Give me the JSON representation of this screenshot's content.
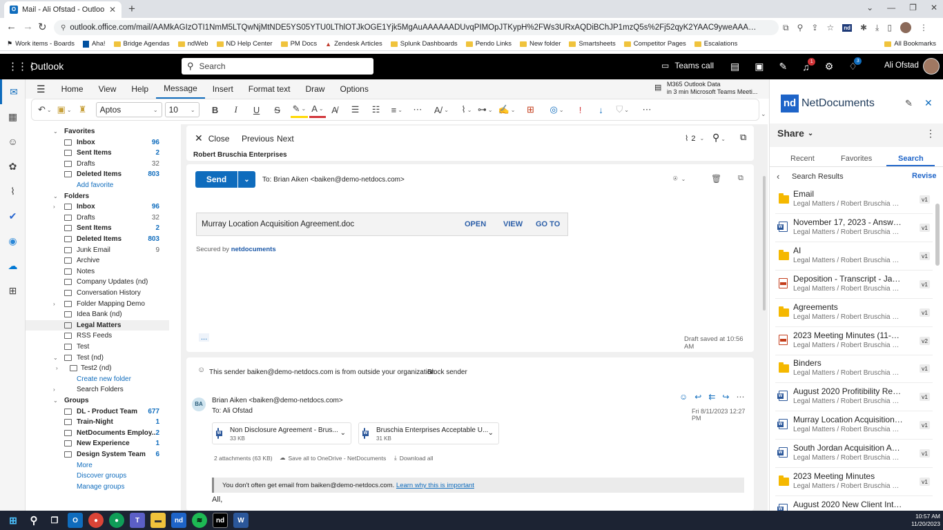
{
  "browser": {
    "tab_title": "Mail - Ali Ofstad - Outlook",
    "new_tab": "+",
    "url": "outlook.office.com/mail/AAMkAGIzOTI1NmM5LTQwNjMtNDE5YS05YTU0LThlOTJkOGE1Yjk5MgAuAAAAAADUvqPIMOpJTKypH%2FWs3URxAQDiBChJP1mzQ5s%2Fj52qyK2YAAC9yweAAAA%3D/id/AAQkAGIzOTI1NmM5LTQwNjMtNDE...",
    "bookmarks": [
      "Work items - Boards",
      "Aha!",
      "Bridge Agendas",
      "ndWeb",
      "ND Help Center",
      "PM Docs",
      "Zendesk Articles",
      "Splunk Dashboards",
      "Pendo Links",
      "New folder",
      "Smartsheets",
      "Competitor Pages",
      "Escalations"
    ],
    "all_bookmarks": "All Bookmarks"
  },
  "header": {
    "app_name": "Outlook",
    "search_placeholder": "Search",
    "teams_call": "Teams call",
    "user_name": "Ali Ofstad",
    "notif_count": "1",
    "tips_count": "3"
  },
  "ribbon": {
    "tabs": [
      "Home",
      "View",
      "Help",
      "Message",
      "Insert",
      "Format text",
      "Draw",
      "Options"
    ],
    "active_tab": "Message",
    "font": "Aptos",
    "size": "10",
    "meeting_title": "M365 Outlook Data",
    "meeting_sub": "in 3 min Microsoft Teams Meeti..."
  },
  "folders": {
    "favorites_label": "Favorites",
    "favorites": [
      {
        "name": "Inbox",
        "count": "96",
        "bold": true
      },
      {
        "name": "Sent Items",
        "count": "2",
        "bold": true
      },
      {
        "name": "Drafts",
        "count": "32",
        "bold": false
      },
      {
        "name": "Deleted Items",
        "count": "803",
        "bold": true
      }
    ],
    "add_favorite": "Add favorite",
    "folders_label": "Folders",
    "items": [
      {
        "name": "Inbox",
        "count": "96",
        "bold": true
      },
      {
        "name": "Drafts",
        "count": "32",
        "bold": false
      },
      {
        "name": "Sent Items",
        "count": "2",
        "bold": true
      },
      {
        "name": "Deleted Items",
        "count": "803",
        "bold": true
      },
      {
        "name": "Junk Email",
        "count": "9",
        "bold": false
      },
      {
        "name": "Archive",
        "count": "",
        "bold": false
      },
      {
        "name": "Notes",
        "count": "",
        "bold": false
      },
      {
        "name": "Company Updates (nd)",
        "count": "",
        "bold": false
      },
      {
        "name": "Conversation History",
        "count": "",
        "bold": false
      },
      {
        "name": "Folder Mapping Demo",
        "count": "",
        "bold": false
      },
      {
        "name": "Idea Bank (nd)",
        "count": "",
        "bold": false
      },
      {
        "name": "Legal Matters",
        "count": "",
        "bold": false
      },
      {
        "name": "RSS Feeds",
        "count": "",
        "bold": false
      },
      {
        "name": "Test",
        "count": "",
        "bold": false
      },
      {
        "name": "Test (nd)",
        "count": "",
        "bold": false
      }
    ],
    "sub_item": "Test2 (nd)",
    "create_new_folder": "Create new folder",
    "search_folders": "Search Folders",
    "groups_label": "Groups",
    "groups": [
      {
        "name": "DL - Product Team",
        "count": "677"
      },
      {
        "name": "Train-Night",
        "count": "1"
      },
      {
        "name": "NetDocuments Employ...",
        "count": "2"
      },
      {
        "name": "New Experience",
        "count": "1"
      },
      {
        "name": "Design System Team",
        "count": "6"
      }
    ],
    "more": "More",
    "discover_groups": "Discover groups",
    "manage_groups": "Manage groups"
  },
  "compose": {
    "close": "Close",
    "previous": "Previous",
    "next": "Next",
    "attach_count": "2",
    "subject": "Robert Bruschia Enterprises",
    "send": "Send",
    "to": "To: Brian Aiken <baiken@demo-netdocs.com>",
    "doc_name": "Murray Location Acquisition Agreement.doc",
    "open": "OPEN",
    "view": "VIEW",
    "goto": "GO TO",
    "secured_by": "Secured by",
    "secured_brand": "netdocuments",
    "ellipsis": "...",
    "draft_saved": "Draft saved at 10:56 AM"
  },
  "message": {
    "external_warning": "This sender baiken@demo-netdocs.com is from outside your organization.",
    "block_sender": "Block sender",
    "avatar": "BA",
    "from": "Brian Aiken <baiken@demo-netdocs.com>",
    "to": "To: Ali Ofstad",
    "date": "Fri 8/11/2023 12:27 PM",
    "attachments": [
      {
        "name": "Non Disclosure Agreement - Brus...",
        "size": "33 KB"
      },
      {
        "name": "Bruschia Enterprises Acceptable U...",
        "size": "31 KB"
      }
    ],
    "attach_summary": "2 attachments (63 KB)",
    "save_all": "Save all to OneDrive - NetDocuments",
    "download_all": "Download all",
    "infrequent": "You don't often get email from baiken@demo-netdocs.com.",
    "learn_why": "Learn why this is important",
    "body_start": "All,"
  },
  "nd_panel": {
    "logo": "nd",
    "brand": "NetDocuments",
    "share": "Share",
    "tabs": [
      "Recent",
      "Favorites",
      "Search"
    ],
    "active_tab": "Search",
    "results_label": "Search Results",
    "revise": "Revise",
    "results": [
      {
        "type": "folder",
        "title": "Email",
        "path": "Legal Matters / Robert Bruschia Ente...",
        "ver": "v1"
      },
      {
        "type": "word",
        "title": "November 17, 2023 - Answers",
        "path": "Legal Matters / Robert Bruschia Ente...",
        "ver": "v1"
      },
      {
        "type": "folder",
        "title": "AI",
        "path": "Legal Matters / Robert Bruschia Ente...",
        "ver": "v1"
      },
      {
        "type": "pdf",
        "title": "Deposition - Transcript - James ...",
        "path": "Legal Matters / Robert Bruschia Ente...",
        "ver": "v1"
      },
      {
        "type": "folder",
        "title": "Agreements",
        "path": "Legal Matters / Robert Bruschia Ente...",
        "ver": "v1"
      },
      {
        "type": "pdf",
        "title": "2023 Meeting Minutes (11-17-2...",
        "path": "Legal Matters / Robert Bruschia Ente...",
        "ver": "v2"
      },
      {
        "type": "folder",
        "title": "Binders",
        "path": "Legal Matters / Robert Bruschia Ente...",
        "ver": "v1"
      },
      {
        "type": "word",
        "title": "August 2020 Profitibility Report",
        "path": "Legal Matters / Robert Bruschia Ente...",
        "ver": "v1"
      },
      {
        "type": "word",
        "title": "Murray Location Acquisition Ag...",
        "path": "Legal Matters / Robert Bruschia Ente...",
        "ver": "v1"
      },
      {
        "type": "word",
        "title": "South Jordan Acquisition Agree...",
        "path": "Legal Matters / Robert Bruschia Ente...",
        "ver": "v1"
      },
      {
        "type": "folder",
        "title": "2023 Meeting Minutes",
        "path": "Legal Matters / Robert Bruschia Ente...",
        "ver": "v1"
      },
      {
        "type": "word",
        "title": "August 2020 New Client Intake ...",
        "path": "",
        "ver": ""
      }
    ]
  },
  "taskbar": {
    "time": "10:57 AM",
    "date": "11/20/2023"
  },
  "colors": {
    "accent": "#0f6cbd",
    "nd_blue": "#1e64c8",
    "folder": "#f5b800"
  }
}
